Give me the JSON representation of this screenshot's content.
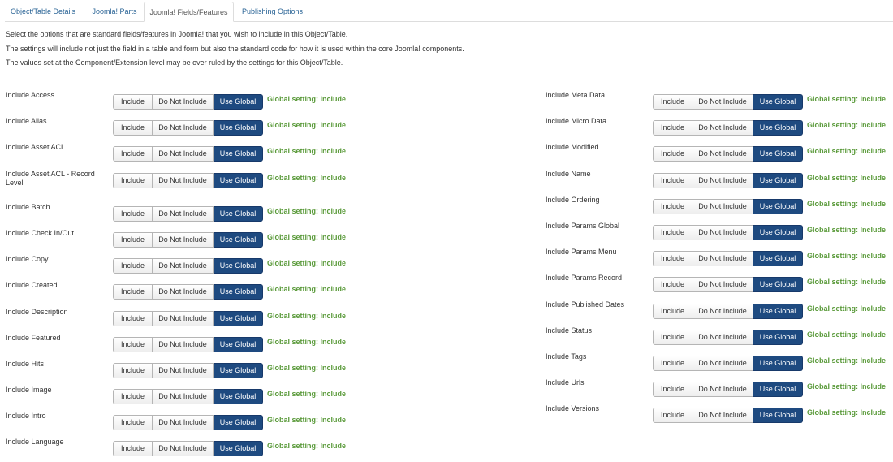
{
  "tabs": [
    {
      "label": "Object/Table Details"
    },
    {
      "label": "Joomla! Parts"
    },
    {
      "label": "Joomla! Fields/Features"
    },
    {
      "label": "Publishing Options"
    }
  ],
  "intro": [
    "Select the options that are standard fields/features in Joomla! that you wish to include in this Object/Table.",
    "The settings will include not just the field in a table and form but also the standard code for how it is used within the core Joomla! components.",
    "The values set at the Component/Extension level may be over ruled by the settings for this Object/Table."
  ],
  "options": {
    "include": "Include",
    "exclude": "Do Not Include",
    "global": "Use Global"
  },
  "global_note": "Global setting: Include",
  "colors": {
    "active": "#1e4a80",
    "global_text": "#5a9a3a",
    "tab_link": "#2a6496"
  },
  "left_fields": [
    {
      "label": "Include Access",
      "selected": "global"
    },
    {
      "label": "Include Alias",
      "selected": "global"
    },
    {
      "label": "Include Asset ACL",
      "selected": "global"
    },
    {
      "label": "Include Asset ACL - Record Level",
      "selected": "global"
    },
    {
      "label": "Include Batch",
      "selected": "global"
    },
    {
      "label": "Include Check In/Out",
      "selected": "global"
    },
    {
      "label": "Include Copy",
      "selected": "global"
    },
    {
      "label": "Include Created",
      "selected": "global"
    },
    {
      "label": "Include Description",
      "selected": "global"
    },
    {
      "label": "Include Featured",
      "selected": "global"
    },
    {
      "label": "Include Hits",
      "selected": "global"
    },
    {
      "label": "Include Image",
      "selected": "global"
    },
    {
      "label": "Include Intro",
      "selected": "global"
    },
    {
      "label": "Include Language",
      "selected": "global"
    }
  ],
  "right_fields": [
    {
      "label": "Include Meta Data",
      "selected": "global"
    },
    {
      "label": "Include Micro Data",
      "selected": "global"
    },
    {
      "label": "Include Modified",
      "selected": "global"
    },
    {
      "label": "Include Name",
      "selected": "global"
    },
    {
      "label": "Include Ordering",
      "selected": "global"
    },
    {
      "label": "Include Params Global",
      "selected": "global"
    },
    {
      "label": "Include Params Menu",
      "selected": "global"
    },
    {
      "label": "Include Params Record",
      "selected": "global"
    },
    {
      "label": "Include Published Dates",
      "selected": "global"
    },
    {
      "label": "Include Status",
      "selected": "global"
    },
    {
      "label": "Include Tags",
      "selected": "global"
    },
    {
      "label": "Include Urls",
      "selected": "global"
    },
    {
      "label": "Include Versions",
      "selected": "global"
    }
  ]
}
